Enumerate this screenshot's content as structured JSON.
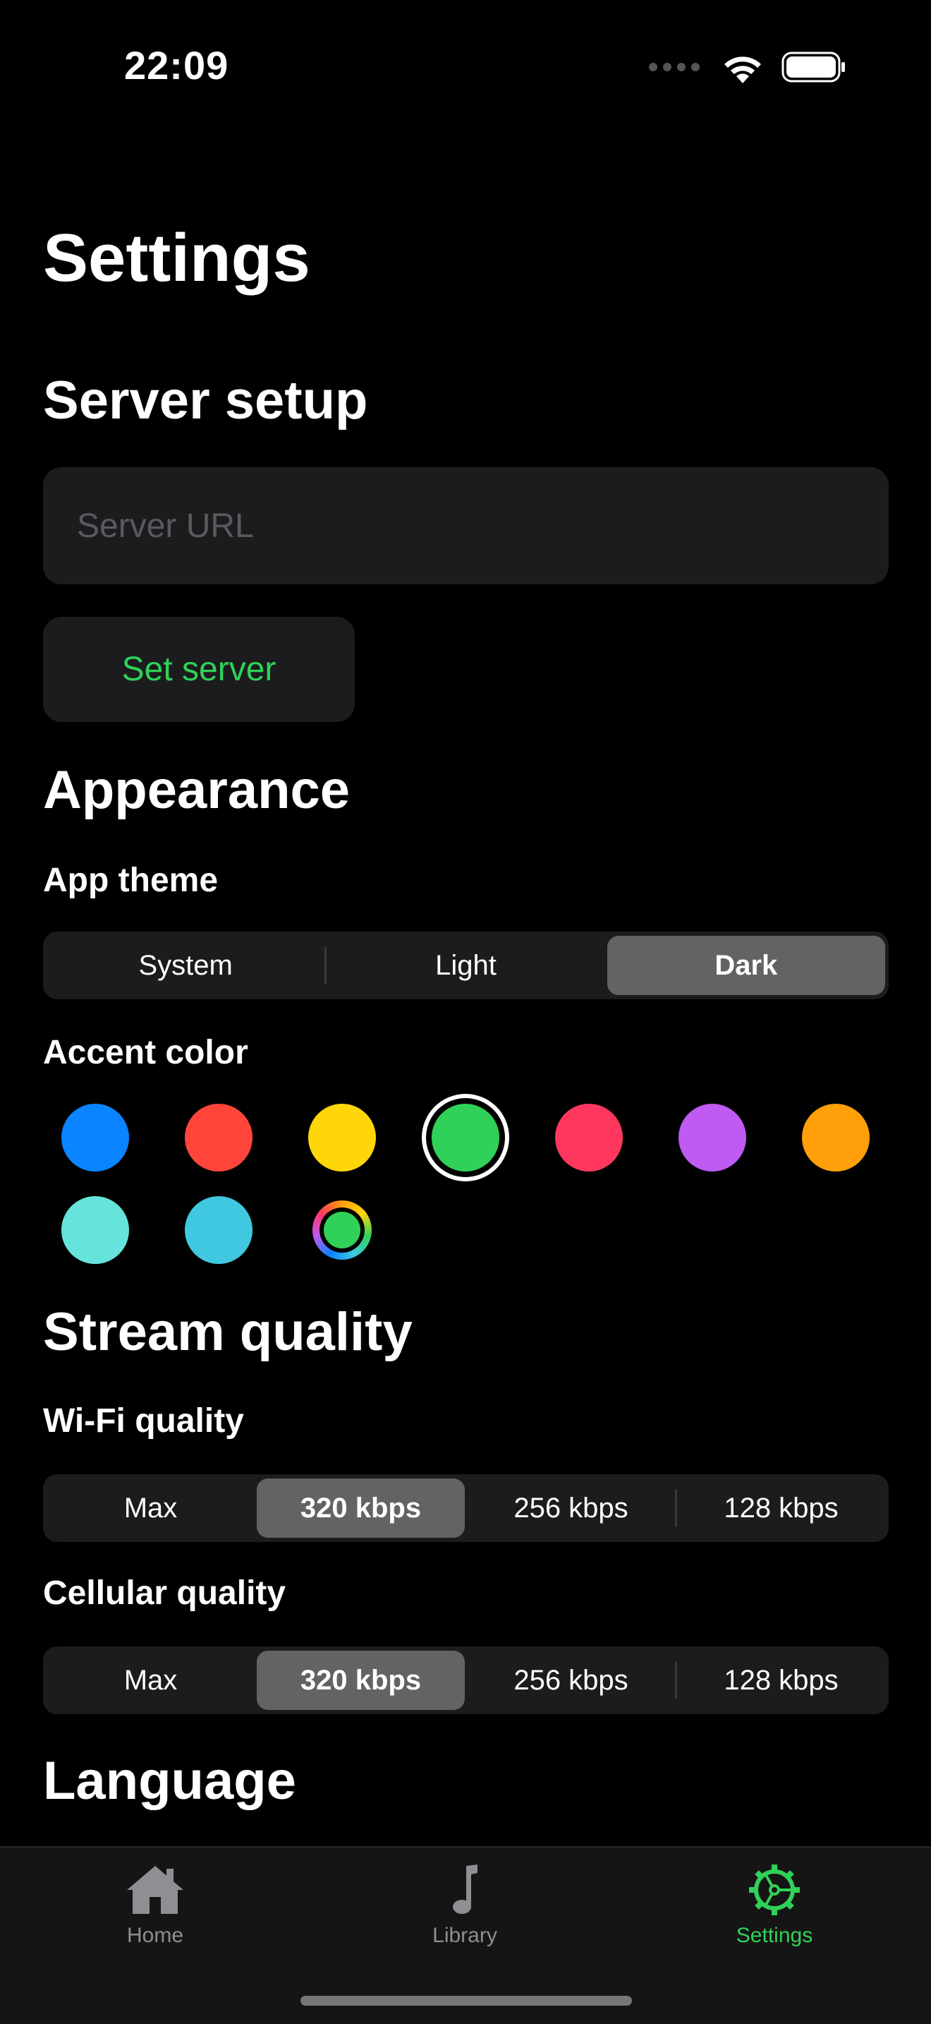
{
  "status_bar": {
    "time": "22:09",
    "icons": [
      "cellular-dots-icon",
      "wifi-icon",
      "battery-icon"
    ]
  },
  "page_title": "Settings",
  "server_setup": {
    "title": "Server setup",
    "url_placeholder": "Server URL",
    "url_value": "",
    "set_button": "Set server"
  },
  "appearance": {
    "title": "Appearance",
    "theme_label": "App theme",
    "theme_options": [
      "System",
      "Light",
      "Dark"
    ],
    "theme_selected": "Dark",
    "accent_label": "Accent color",
    "accent_colors": [
      "#0a84ff",
      "#ff453a",
      "#ffd60a",
      "#30d158",
      "#ff375f",
      "#bf5af2",
      "#ff9f0a",
      "#66e4dc",
      "#40c8e0",
      "multicolor"
    ],
    "accent_selected": "#30d158"
  },
  "stream_quality": {
    "title": "Stream quality",
    "wifi_label": "Wi-Fi quality",
    "wifi_options": [
      "Max",
      "320 kbps",
      "256 kbps",
      "128 kbps"
    ],
    "wifi_selected": "320 kbps",
    "cellular_label": "Cellular quality",
    "cellular_options": [
      "Max",
      "320 kbps",
      "256 kbps",
      "128 kbps"
    ],
    "cellular_selected": "320 kbps"
  },
  "language": {
    "title": "Language"
  },
  "tab_bar": {
    "items": [
      {
        "label": "Home",
        "icon": "house-icon"
      },
      {
        "label": "Library",
        "icon": "music-note-icon"
      },
      {
        "label": "Settings",
        "icon": "gear-icon"
      }
    ],
    "active": "Settings",
    "accent": "#30d158"
  }
}
